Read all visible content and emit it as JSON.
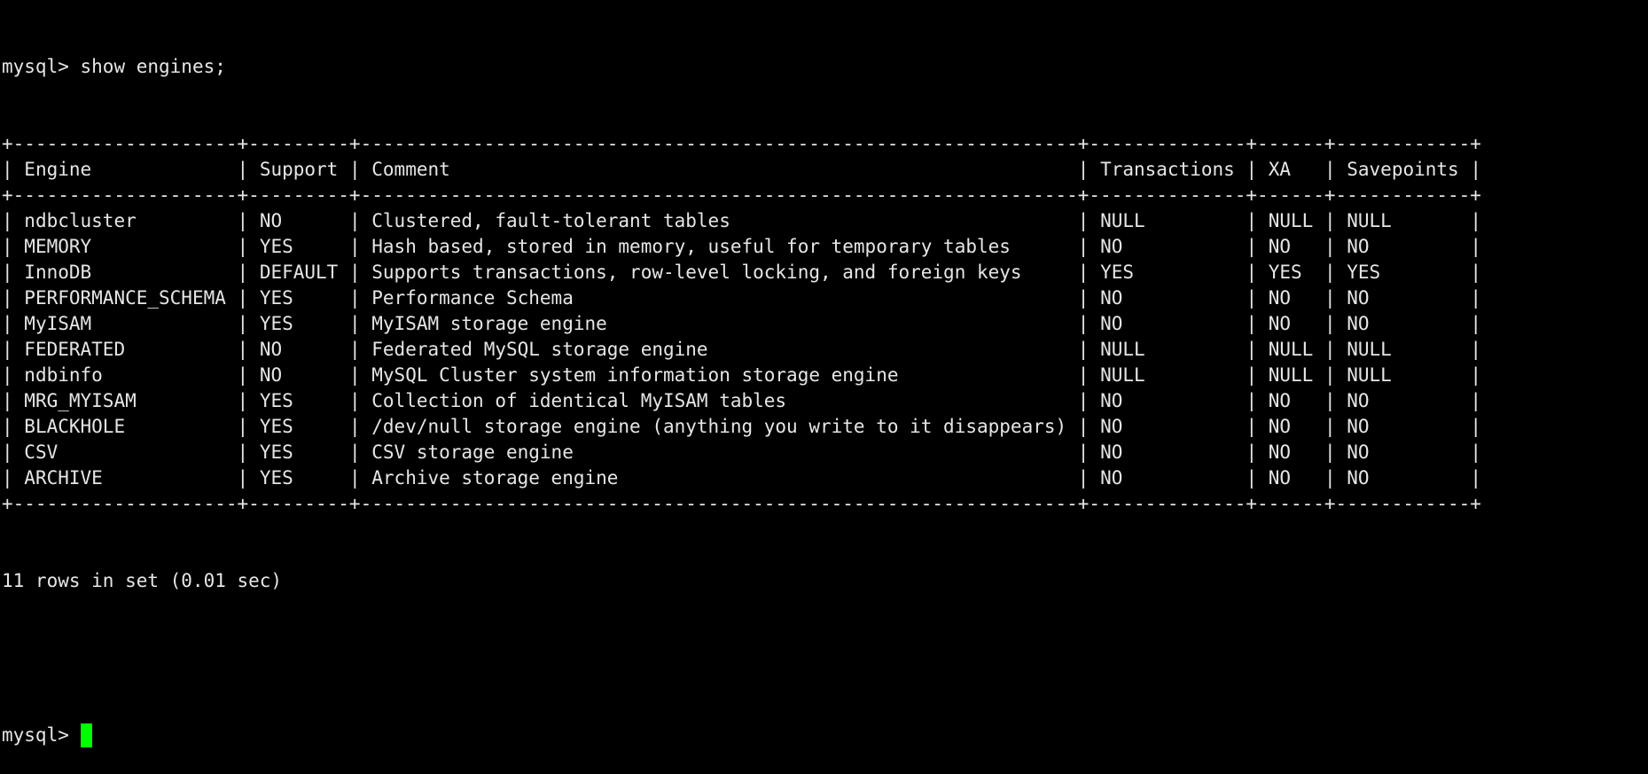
{
  "terminal": {
    "prompt": "mysql> ",
    "command": "show engines;",
    "table": {
      "columns": [
        "Engine",
        "Support",
        "Comment",
        "Transactions",
        "XA",
        "Savepoints"
      ],
      "rows": [
        [
          "ndbcluster",
          "NO",
          "Clustered, fault-tolerant tables",
          "NULL",
          "NULL",
          "NULL"
        ],
        [
          "MEMORY",
          "YES",
          "Hash based, stored in memory, useful for temporary tables",
          "NO",
          "NO",
          "NO"
        ],
        [
          "InnoDB",
          "DEFAULT",
          "Supports transactions, row-level locking, and foreign keys",
          "YES",
          "YES",
          "YES"
        ],
        [
          "PERFORMANCE_SCHEMA",
          "YES",
          "Performance Schema",
          "NO",
          "NO",
          "NO"
        ],
        [
          "MyISAM",
          "YES",
          "MyISAM storage engine",
          "NO",
          "NO",
          "NO"
        ],
        [
          "FEDERATED",
          "NO",
          "Federated MySQL storage engine",
          "NULL",
          "NULL",
          "NULL"
        ],
        [
          "ndbinfo",
          "NO",
          "MySQL Cluster system information storage engine",
          "NULL",
          "NULL",
          "NULL"
        ],
        [
          "MRG_MYISAM",
          "YES",
          "Collection of identical MyISAM tables",
          "NO",
          "NO",
          "NO"
        ],
        [
          "BLACKHOLE",
          "YES",
          "/dev/null storage engine (anything you write to it disappears)",
          "NO",
          "NO",
          "NO"
        ],
        [
          "CSV",
          "YES",
          "CSV storage engine",
          "NO",
          "NO",
          "NO"
        ],
        [
          "ARCHIVE",
          "YES",
          "Archive storage engine",
          "NO",
          "NO",
          "NO"
        ]
      ]
    },
    "result_summary": "11 rows in set (0.01 sec)",
    "cursor_color": "#00ff00"
  }
}
